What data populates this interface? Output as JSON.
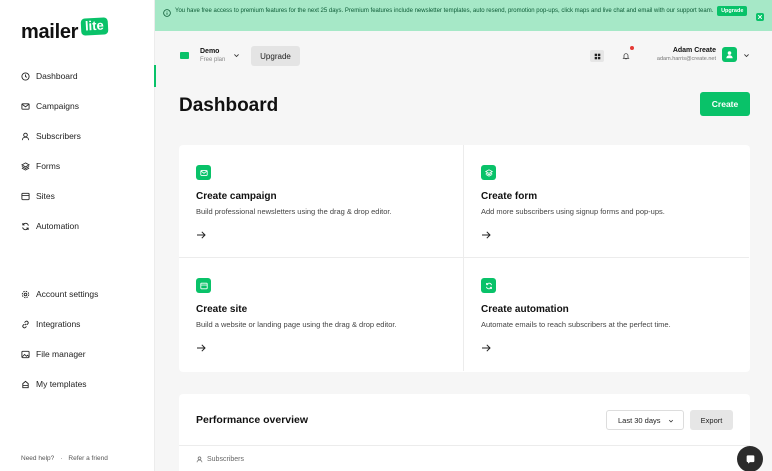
{
  "brand": {
    "logo_text": "mailer",
    "logo_badge": "lite",
    "accent_color": "#09c269"
  },
  "banner": {
    "text": "You have free access to premium features for the next 25 days. Premium features include newsletter templates, auto resend, promotion pop-ups, click maps and live chat and email with our support team.",
    "upgrade_label": "Upgrade",
    "icon": "info-icon",
    "close_icon": "close-icon"
  },
  "sidebar": {
    "items": [
      {
        "label": "Dashboard",
        "icon": "clock-icon",
        "active": true
      },
      {
        "label": "Campaigns",
        "icon": "mail-icon",
        "active": false
      },
      {
        "label": "Subscribers",
        "icon": "user-icon",
        "active": false
      },
      {
        "label": "Forms",
        "icon": "layers-icon",
        "active": false
      },
      {
        "label": "Sites",
        "icon": "browser-icon",
        "active": false
      },
      {
        "label": "Automation",
        "icon": "refresh-icon",
        "active": false
      },
      {
        "label": "Account settings",
        "icon": "gear-icon",
        "active": false
      },
      {
        "label": "Integrations",
        "icon": "link-icon",
        "active": false
      },
      {
        "label": "File manager",
        "icon": "image-icon",
        "active": false
      },
      {
        "label": "My templates",
        "icon": "template-icon",
        "active": false
      }
    ],
    "footer": {
      "help": "Need help?",
      "separator": "·",
      "refer": "Refer a friend"
    }
  },
  "topbar": {
    "workspace_name": "Demo",
    "workspace_plan": "Free plan",
    "upgrade_label": "Upgrade",
    "user_name": "Adam Create",
    "user_email": "adam.harris@create.net"
  },
  "main": {
    "title": "Dashboard",
    "create_label": "Create",
    "cards": [
      {
        "title": "Create campaign",
        "description": "Build professional newsletters using the drag & drop editor.",
        "icon": "mail-icon"
      },
      {
        "title": "Create form",
        "description": "Add more subscribers using signup forms and pop-ups.",
        "icon": "layers-icon"
      },
      {
        "title": "Create site",
        "description": "Build a website or landing page using the drag & drop editor.",
        "icon": "browser-icon"
      },
      {
        "title": "Create automation",
        "description": "Automate emails to reach subscribers at the perfect time.",
        "icon": "refresh-icon"
      }
    ],
    "performance": {
      "title": "Performance overview",
      "range_selected": "Last 30 days",
      "export_label": "Export",
      "tab_label": "Subscribers"
    }
  }
}
